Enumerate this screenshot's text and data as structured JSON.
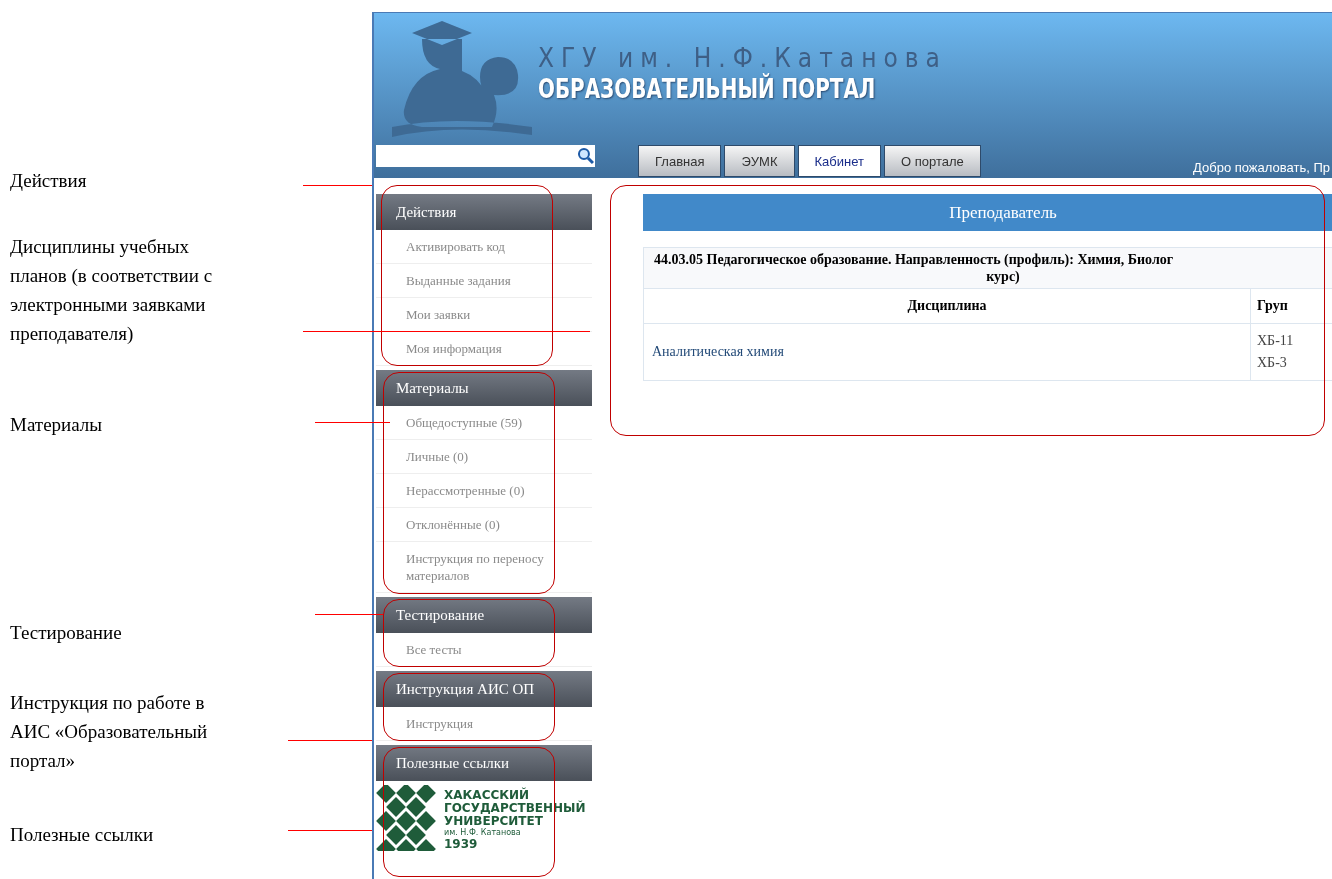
{
  "annotations": [
    {
      "text": "Действия"
    },
    {
      "text": "Дисциплины учебных\nпланов  (в соответствии с\nэлектронными заявками\nпреподавателя)"
    },
    {
      "text": "Материалы"
    },
    {
      "text": "Тестирование"
    },
    {
      "text": "Инструкция по работе в\nАИС «Образовательный\nпортал»"
    },
    {
      "text": "Полезные ссылки"
    }
  ],
  "header": {
    "university": "ХГУ им. Н.Ф.Катанова",
    "portal": "ОБРАЗОВАТЕЛЬНЫЙ ПОРТАЛ"
  },
  "tabs": [
    {
      "label": "Главная",
      "selected": false
    },
    {
      "label": "ЭУМК",
      "selected": false
    },
    {
      "label": "Кабинет",
      "selected": true
    },
    {
      "label": "О портале",
      "selected": false
    }
  ],
  "welcome": "Добро пожаловать, Пр",
  "sidebar": [
    {
      "title": "Действия",
      "items": [
        "Активировать код",
        "Выданные задания",
        "Мои заявки",
        "Моя информация"
      ]
    },
    {
      "title": "Материалы",
      "items": [
        "Общедоступные (59)",
        "Личные (0)",
        "Нерассмотренные (0)",
        "Отклонённые (0)",
        "Инструкция по переносу материалов"
      ]
    },
    {
      "title": "Тестирование",
      "items": [
        "Все тесты"
      ]
    },
    {
      "title": "Инструкция АИС ОП",
      "items": [
        "Инструкция"
      ]
    },
    {
      "title": "Полезные ссылки",
      "logo_lines": [
        "ХАКАССКИЙ",
        "ГОСУДАРСТВЕННЫЙ",
        "УНИВЕРСИТЕТ",
        "им. Н.Ф. Катанова",
        "1939"
      ]
    }
  ],
  "content": {
    "title": "Преподаватель",
    "table": {
      "heading_lines": [
        "44.03.05 Педагогическое образование. Направленность (профиль): Химия, Биолог",
        "курс)"
      ],
      "columns": [
        "Дисциплина",
        "Груп"
      ],
      "rows": [
        {
          "discipline": "Аналитическая химия",
          "groups": [
            "ХБ-11",
            "ХБ-3"
          ]
        }
      ]
    }
  }
}
